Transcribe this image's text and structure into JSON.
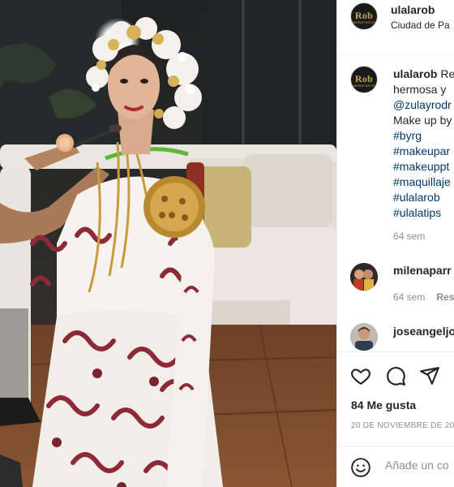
{
  "post": {
    "photo_description_icon": "photo-image",
    "author": {
      "avatar_text": "Rob",
      "avatar_subtext": "MAKEUP ARTIST",
      "username": "ulalarob",
      "separator": "•",
      "location": "Ciudad de Pa"
    },
    "caption": {
      "username": "ulalarob",
      "text_start": "Re",
      "lines": [
        "hermosa y",
        "@zulayrodr",
        "Make up by",
        "#byrg",
        "#makeupar",
        "#makeuppt",
        "#maquillaje",
        "#ulalarob",
        "#ulalatips"
      ],
      "time": "64 sem"
    },
    "comments": [
      {
        "username": "milenaparr",
        "time": "64 sem",
        "reply_label": "Res"
      },
      {
        "username": "joseangeljo"
      }
    ],
    "actions": {
      "like_icon": "heart-icon",
      "comment_icon": "comment-icon",
      "share_icon": "share-icon",
      "likes": "84 Me gusta",
      "date": "20 DE NOVIEMBRE DE 20"
    },
    "add_comment": {
      "emoji_icon": "emoji-icon",
      "placeholder": "Añade un co"
    }
  },
  "colors": {
    "link": "#00376b",
    "muted": "#8e8e8e",
    "text": "#262626",
    "border": "#efefef"
  }
}
